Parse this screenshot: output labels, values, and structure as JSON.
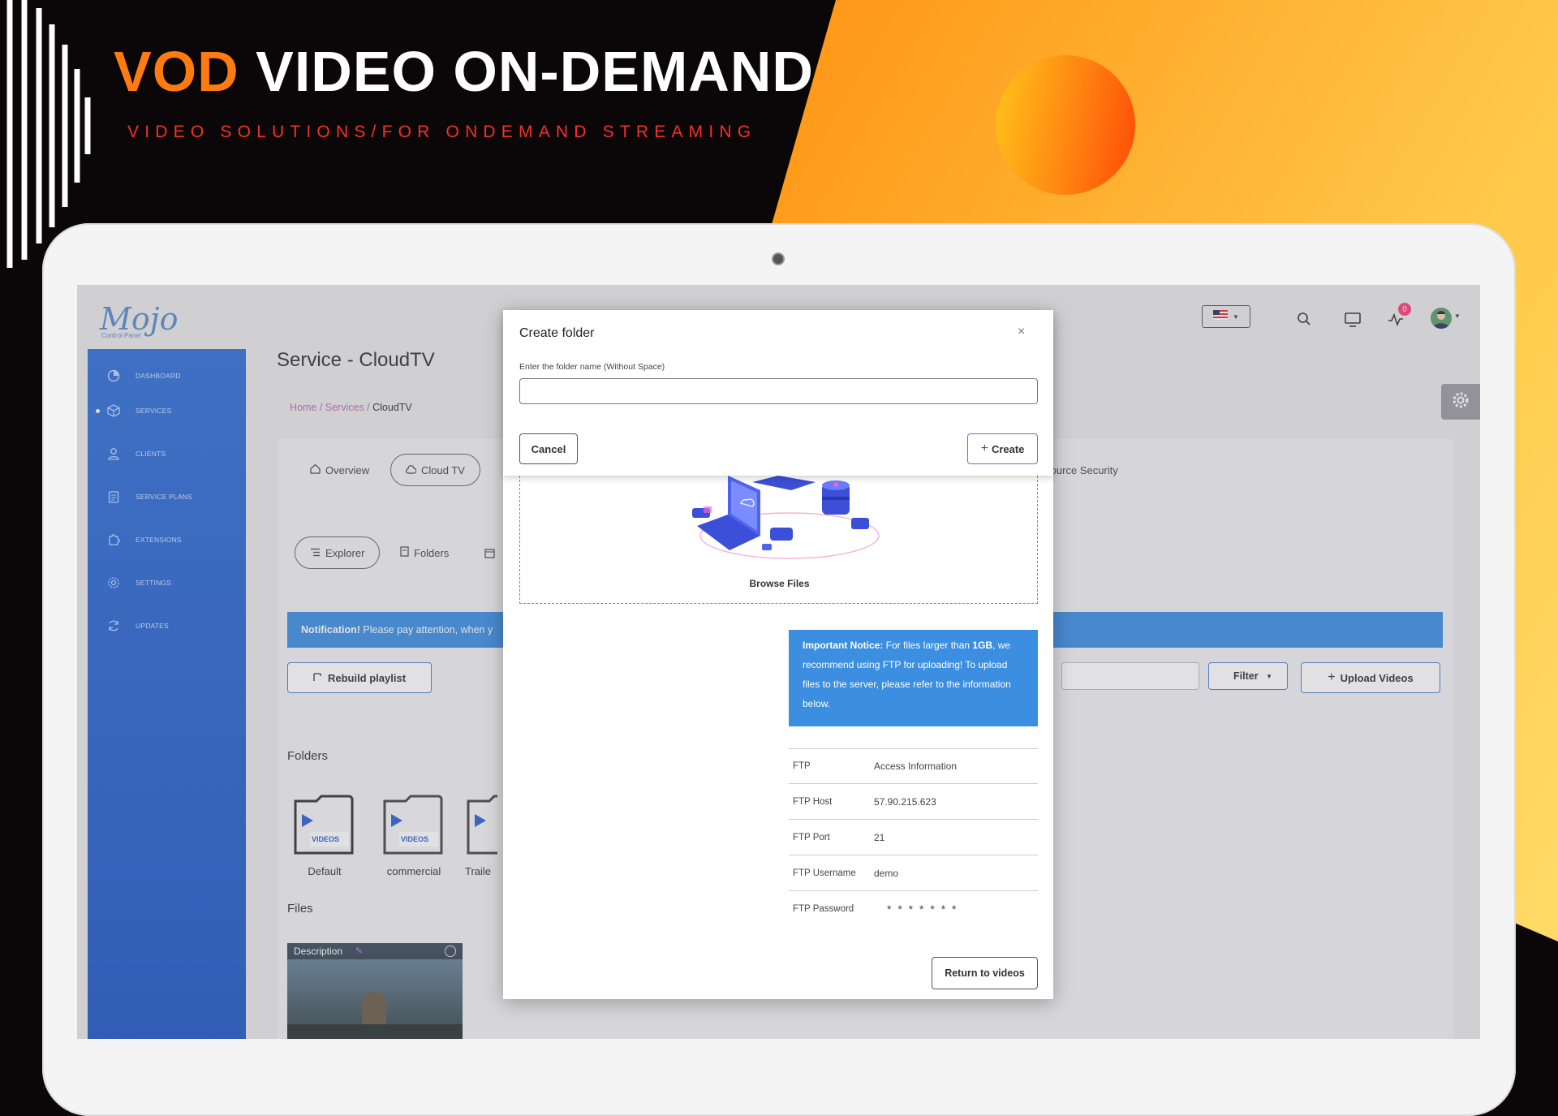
{
  "banner": {
    "title_accent": "VOD",
    "title_rest": " VIDEO ON-DEMAND",
    "subtitle": "VIDEO SOLUTIONS/FOR ONDEMAND STREAMING"
  },
  "app": {
    "logo": "Mojo",
    "logo_sub": "Control Panel",
    "page_title": "Service - CloudTV",
    "breadcrumb": [
      "Home",
      "Services",
      "CloudTV"
    ],
    "notification_badge": "0"
  },
  "sidebar": {
    "items": [
      {
        "label": "DASHBOARD",
        "icon": "dashboard-icon"
      },
      {
        "label": "SERVICES",
        "icon": "box-icon",
        "active": true
      },
      {
        "label": "CLIENTS",
        "icon": "user-icon"
      },
      {
        "label": "SERVICE PLANS",
        "icon": "clipboard-icon"
      },
      {
        "label": "EXTENSIONS",
        "icon": "puzzle-icon"
      },
      {
        "label": "SETTINGS",
        "icon": "gear-icon"
      },
      {
        "label": "UPDATES",
        "icon": "refresh-icon"
      }
    ]
  },
  "tabs": {
    "overview": "Overview",
    "cloud_tv": "Cloud TV",
    "source_security": "Source Security",
    "explorer": "Explorer",
    "folders": "Folders"
  },
  "notification": {
    "strong": "Notification!",
    "text": " Please pay attention, when y"
  },
  "actions": {
    "rebuild": "Rebuild playlist",
    "filter": "Filter",
    "upload": "Upload Videos"
  },
  "sections": {
    "folders_heading": "Folders",
    "files_heading": "Files",
    "folders": [
      "Default",
      "commercial",
      "Traile"
    ],
    "folder_badge": "VIDEOS",
    "file_description": "Description"
  },
  "modal": {
    "title": "Create folder",
    "close": "×",
    "field_label": "Enter the folder name (Without Space)",
    "input_value": "",
    "cancel": "Cancel",
    "create": "Create",
    "browse_files": "Browse Files",
    "notice_strong": "Important Notice:",
    "notice_text_1": " For files larger than ",
    "notice_size": "1GB",
    "notice_text_2": ", we recommend using FTP for uploading! To upload files to the server, please refer to the information below.",
    "ftp": {
      "head_key": "FTP",
      "head_value": "Access Information",
      "rows": [
        {
          "key": "FTP Host",
          "value": "57.90.215.623"
        },
        {
          "key": "FTP Port",
          "value": "21"
        },
        {
          "key": "FTP Username",
          "value": "demo"
        },
        {
          "key": "FTP Password",
          "value": "* * * * * * *"
        }
      ]
    },
    "return": "Return to videos"
  },
  "colors": {
    "accent_orange": "#ff7b12",
    "subtitle_red": "#f0332b",
    "sidebar_blue": "#2f6fd6",
    "notice_blue": "#3b8ee0",
    "badge_pink": "#ff3b77"
  }
}
